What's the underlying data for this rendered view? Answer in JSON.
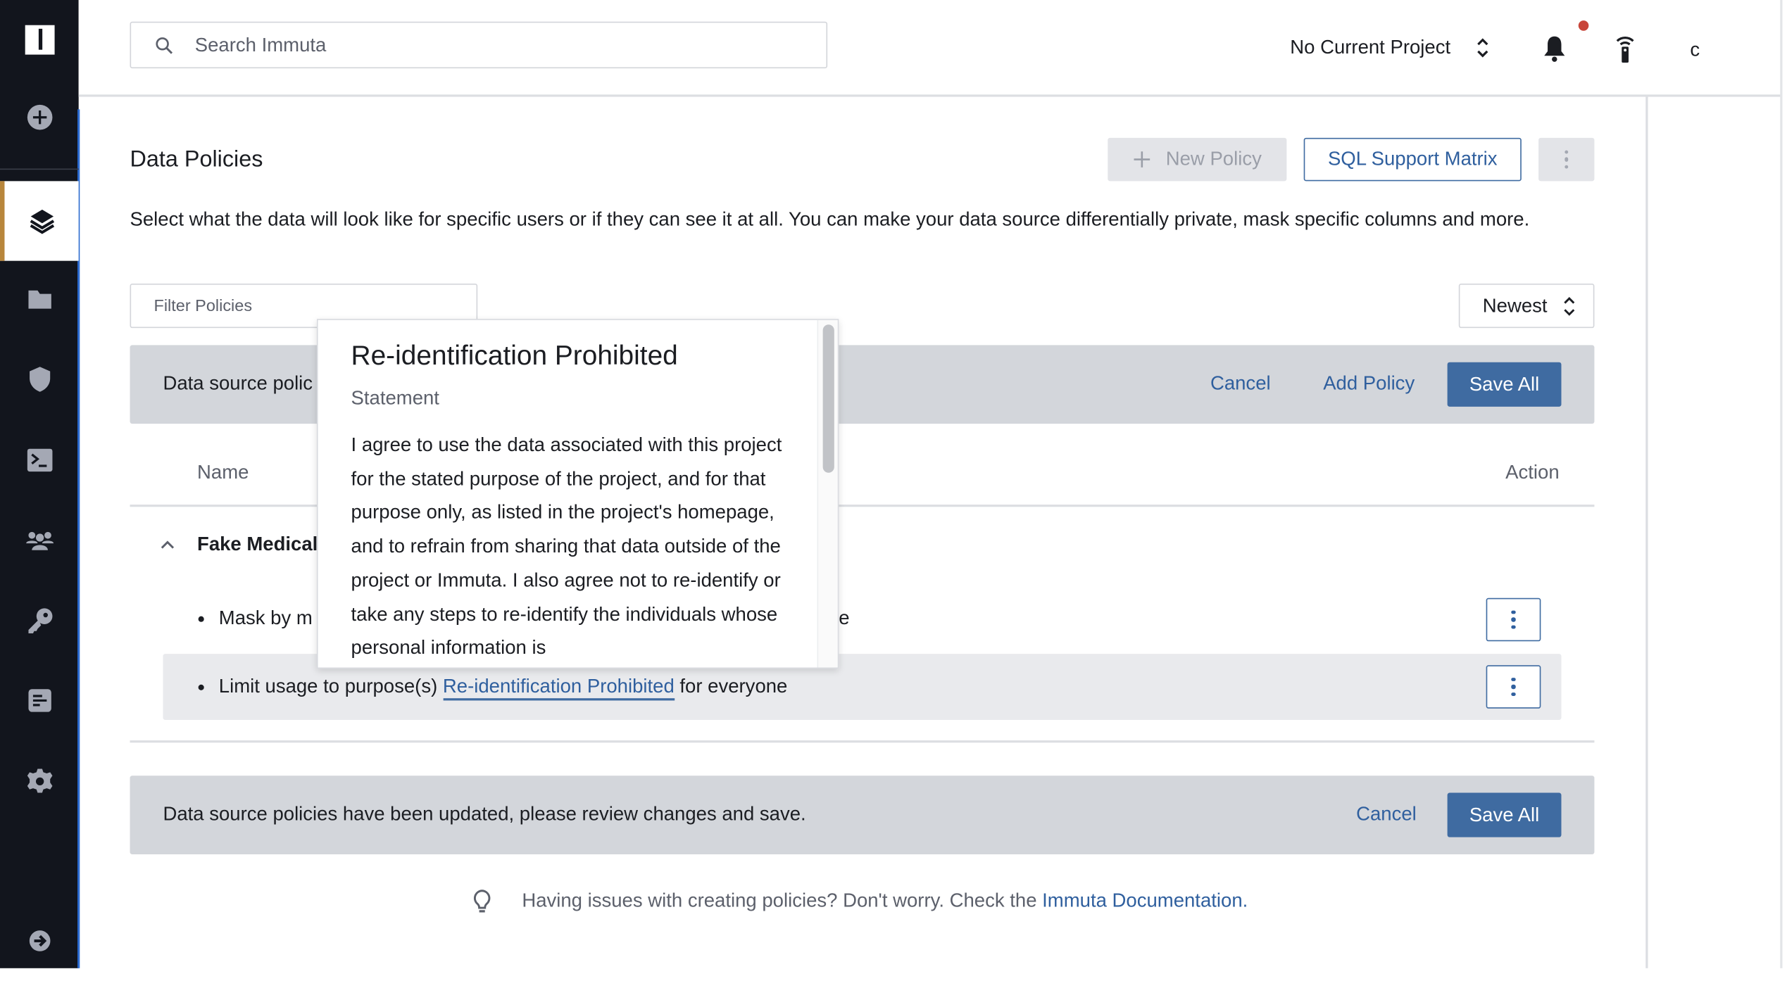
{
  "sidebar": {
    "items": [
      {
        "icon": "logo-icon"
      },
      {
        "icon": "add-circle-icon"
      },
      {
        "icon": "layers-icon",
        "active": true
      },
      {
        "icon": "folder-icon"
      },
      {
        "icon": "shield-icon"
      },
      {
        "icon": "terminal-icon"
      },
      {
        "icon": "users-icon"
      },
      {
        "icon": "key-icon"
      },
      {
        "icon": "report-icon"
      },
      {
        "icon": "gear-icon"
      },
      {
        "icon": "arrow-right-circle-icon"
      }
    ],
    "active_color": "#b8863b"
  },
  "header": {
    "search_placeholder": "Search Immuta",
    "project": "No Current Project",
    "user_initial": "c",
    "notification_dot_color": "#c8453a"
  },
  "page": {
    "title": "Data Policies",
    "new_policy": "New Policy",
    "sql_matrix": "SQL Support Matrix",
    "description": "Select what the data will look like for specific users or if they can see it at all. You can make your data source differentially private, mask specific columns and more.",
    "filter_placeholder": "Filter Policies",
    "sort": "Newest",
    "top_bar": {
      "text": "Data source polic",
      "cancel": "Cancel",
      "add_policy": "Add Policy",
      "save_all": "Save All"
    },
    "table": {
      "col_name": "Name",
      "col_action": "Action"
    },
    "group": {
      "name": "Fake Medical",
      "rows": [
        {
          "text": "Mask by m",
          "trailing": "e"
        },
        {
          "prefix": "Limit usage to purpose(s) ",
          "link": "Re-identification Prohibited",
          "suffix": " for everyone"
        }
      ]
    },
    "bottom_bar": {
      "text": "Data source policies have been updated, please review changes and save.",
      "cancel": "Cancel",
      "save_all": "Save All"
    },
    "help": {
      "text": "Having issues with creating policies? Don't worry. Check the ",
      "link": "Immuta Documentation",
      "end": "."
    }
  },
  "popover": {
    "title": "Re-identification Prohibited",
    "subtitle": "Statement",
    "body": "I agree to use the data associated with this project for the stated purpose of the project, and for that purpose only, as listed in the project's homepage, and to refrain from sharing that data outside of the project or Immuta. I also agree not to re-identify or take any steps to re-identify the individuals whose personal information is"
  },
  "colors": {
    "primary": "#3f6ba1",
    "link": "#2f5f9e",
    "bar_bg": "#d3d6db",
    "sidebar_bg": "#12151d"
  }
}
